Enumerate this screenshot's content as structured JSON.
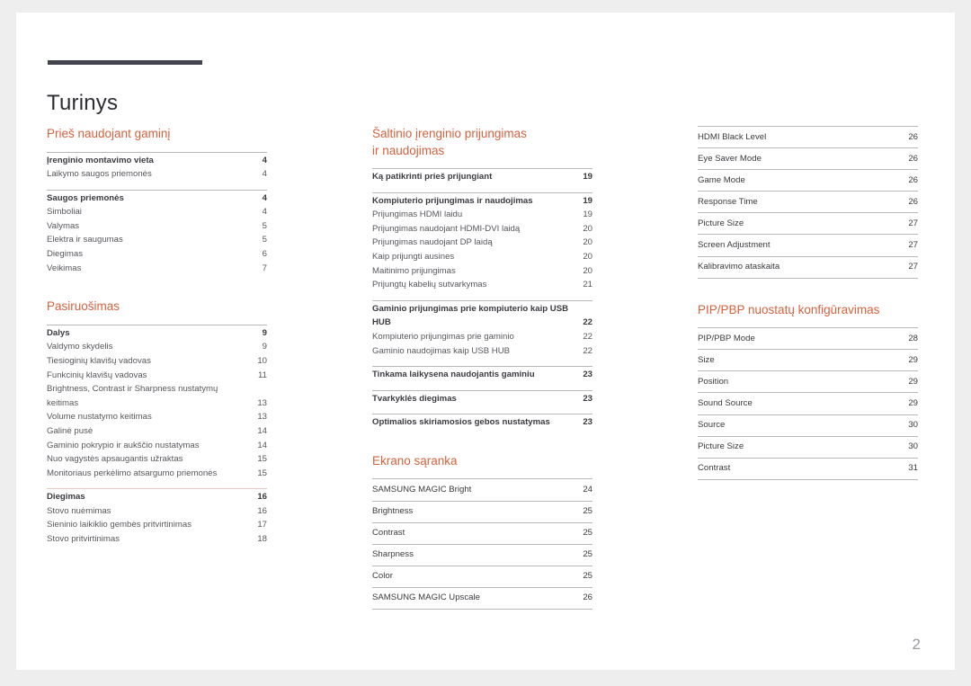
{
  "document": {
    "title": "Turinys",
    "footer_page_number": "2",
    "accent_color": "#d4623f",
    "rule_color": "#44444f",
    "text_color": "#3a3a40"
  },
  "columns": [
    {
      "name": "column-1",
      "sections": [
        {
          "heading": "Prieš naudojant gaminį",
          "groups": [
            {
              "style": "plain",
              "rows": [
                {
                  "label": "Įrenginio montavimo vieta",
                  "page": "4",
                  "level": 1
                },
                {
                  "label": "Laikymo saugos priemonės",
                  "page": "4",
                  "level": 2
                }
              ]
            },
            {
              "style": "plain",
              "rows": [
                {
                  "label": "Saugos priemonės",
                  "page": "4",
                  "level": 1
                },
                {
                  "label": "Simboliai",
                  "page": "4",
                  "level": 2
                },
                {
                  "label": "Valymas",
                  "page": "5",
                  "level": 2
                },
                {
                  "label": "Elektra ir saugumas",
                  "page": "5",
                  "level": 2
                },
                {
                  "label": "Diegimas",
                  "page": "6",
                  "level": 2
                },
                {
                  "label": "Veikimas",
                  "page": "7",
                  "level": 2
                }
              ]
            }
          ]
        },
        {
          "heading": "Pasiruošimas",
          "groups": [
            {
              "style": "plain",
              "rows": [
                {
                  "label": "Dalys",
                  "page": "9",
                  "level": 1
                },
                {
                  "label": "Valdymo skydelis",
                  "page": "9",
                  "level": 2
                },
                {
                  "label": "Tiesioginių klavišų vadovas",
                  "page": "10",
                  "level": 2
                },
                {
                  "label": "Funkcinių klavišų vadovas",
                  "page": "11",
                  "level": 2
                },
                {
                  "label": "Brightness, Contrast ir Sharpness nustatymų keitimas",
                  "page": "13",
                  "level": 2
                },
                {
                  "label": "Volume nustatymo keitimas",
                  "page": "13",
                  "level": 2
                },
                {
                  "label": "Galinė pusė",
                  "page": "14",
                  "level": 2
                },
                {
                  "label": "Gaminio pokrypio ir aukščio nustatymas",
                  "page": "14",
                  "level": 2
                },
                {
                  "label": "Nuo vagystės apsaugantis užraktas",
                  "page": "15",
                  "level": 2
                },
                {
                  "label": "Monitoriaus perkėlimo atsargumo priemonės",
                  "page": "15",
                  "level": 2
                }
              ]
            },
            {
              "style": "soft",
              "rows": [
                {
                  "label": "Diegimas",
                  "page": "16",
                  "level": 1
                },
                {
                  "label": "Stovo nuėmimas",
                  "page": "16",
                  "level": 2
                },
                {
                  "label": "Sieninio laikiklio gembės pritvirtinimas",
                  "page": "17",
                  "level": 2
                },
                {
                  "label": "Stovo pritvirtinimas",
                  "page": "18",
                  "level": 2
                }
              ]
            }
          ]
        }
      ]
    },
    {
      "name": "column-2",
      "sections": [
        {
          "heading": "Šaltinio įrenginio prijungimas\nir naudojimas",
          "groups": [
            {
              "style": "plain",
              "rows": [
                {
                  "label": "Ką patikrinti prieš prijungiant",
                  "page": "19",
                  "level": 1
                }
              ]
            },
            {
              "style": "plain",
              "rows": [
                {
                  "label": "Kompiuterio prijungimas ir naudojimas",
                  "page": "19",
                  "level": 1
                },
                {
                  "label": "Prijungimas HDMI laidu",
                  "page": "19",
                  "level": 2
                },
                {
                  "label": "Prijungimas naudojant HDMI-DVI laidą",
                  "page": "20",
                  "level": 2
                },
                {
                  "label": "Prijungimas naudojant DP laidą",
                  "page": "20",
                  "level": 2
                },
                {
                  "label": "Kaip prijungti ausines",
                  "page": "20",
                  "level": 2
                },
                {
                  "label": "Maitinimo prijungimas",
                  "page": "20",
                  "level": 2
                },
                {
                  "label": "Prijungtų kabelių sutvarkymas",
                  "page": "21",
                  "level": 2
                }
              ]
            },
            {
              "style": "plain",
              "rows": [
                {
                  "label": "Gaminio prijungimas prie kompiuterio kaip USB HUB",
                  "page": "22",
                  "level": 1
                },
                {
                  "label": "Kompiuterio prijungimas prie gaminio",
                  "page": "22",
                  "level": 2
                },
                {
                  "label": "Gaminio naudojimas kaip USB HUB",
                  "page": "22",
                  "level": 2
                }
              ]
            },
            {
              "style": "plain",
              "rows": [
                {
                  "label": "Tinkama laikysena naudojantis gaminiu",
                  "page": "23",
                  "level": 1
                }
              ]
            },
            {
              "style": "plain",
              "rows": [
                {
                  "label": "Tvarkyklės diegimas",
                  "page": "23",
                  "level": 1
                }
              ]
            },
            {
              "style": "plain",
              "rows": [
                {
                  "label": "Optimalios skiriamosios gebos nustatymas",
                  "page": "23",
                  "level": 1
                }
              ]
            }
          ]
        },
        {
          "heading": "Ekrano sąranka",
          "groups": [
            {
              "style": "ruled",
              "rows": [
                {
                  "label": "SAMSUNG MAGIC Bright",
                  "page": "24",
                  "level": 1
                },
                {
                  "label": "Brightness",
                  "page": "25",
                  "level": 1
                },
                {
                  "label": "Contrast",
                  "page": "25",
                  "level": 1
                },
                {
                  "label": "Sharpness",
                  "page": "25",
                  "level": 1
                },
                {
                  "label": "Color",
                  "page": "25",
                  "level": 1
                },
                {
                  "label": "SAMSUNG MAGIC Upscale",
                  "page": "26",
                  "level": 1
                }
              ]
            }
          ]
        }
      ]
    },
    {
      "name": "column-3",
      "sections": [
        {
          "heading": "",
          "groups": [
            {
              "style": "ruled",
              "rows": [
                {
                  "label": "HDMI Black Level",
                  "page": "26",
                  "level": 1
                },
                {
                  "label": "Eye Saver Mode",
                  "page": "26",
                  "level": 1
                },
                {
                  "label": "Game Mode",
                  "page": "26",
                  "level": 1
                },
                {
                  "label": "Response Time",
                  "page": "26",
                  "level": 1
                },
                {
                  "label": "Picture Size",
                  "page": "27",
                  "level": 1
                },
                {
                  "label": "Screen Adjustment",
                  "page": "27",
                  "level": 1
                },
                {
                  "label": "Kalibravimo ataskaita",
                  "page": "27",
                  "level": 1
                }
              ]
            }
          ]
        },
        {
          "heading": "PIP/PBP nuostatų konfigūravimas",
          "groups": [
            {
              "style": "ruled",
              "rows": [
                {
                  "label": "PIP/PBP Mode",
                  "page": "28",
                  "level": 1
                },
                {
                  "label": "Size",
                  "page": "29",
                  "level": 1
                },
                {
                  "label": "Position",
                  "page": "29",
                  "level": 1
                },
                {
                  "label": "Sound Source",
                  "page": "29",
                  "level": 1
                },
                {
                  "label": "Source",
                  "page": "30",
                  "level": 1
                },
                {
                  "label": "Picture Size",
                  "page": "30",
                  "level": 1
                },
                {
                  "label": "Contrast",
                  "page": "31",
                  "level": 1
                }
              ]
            }
          ]
        }
      ]
    }
  ]
}
